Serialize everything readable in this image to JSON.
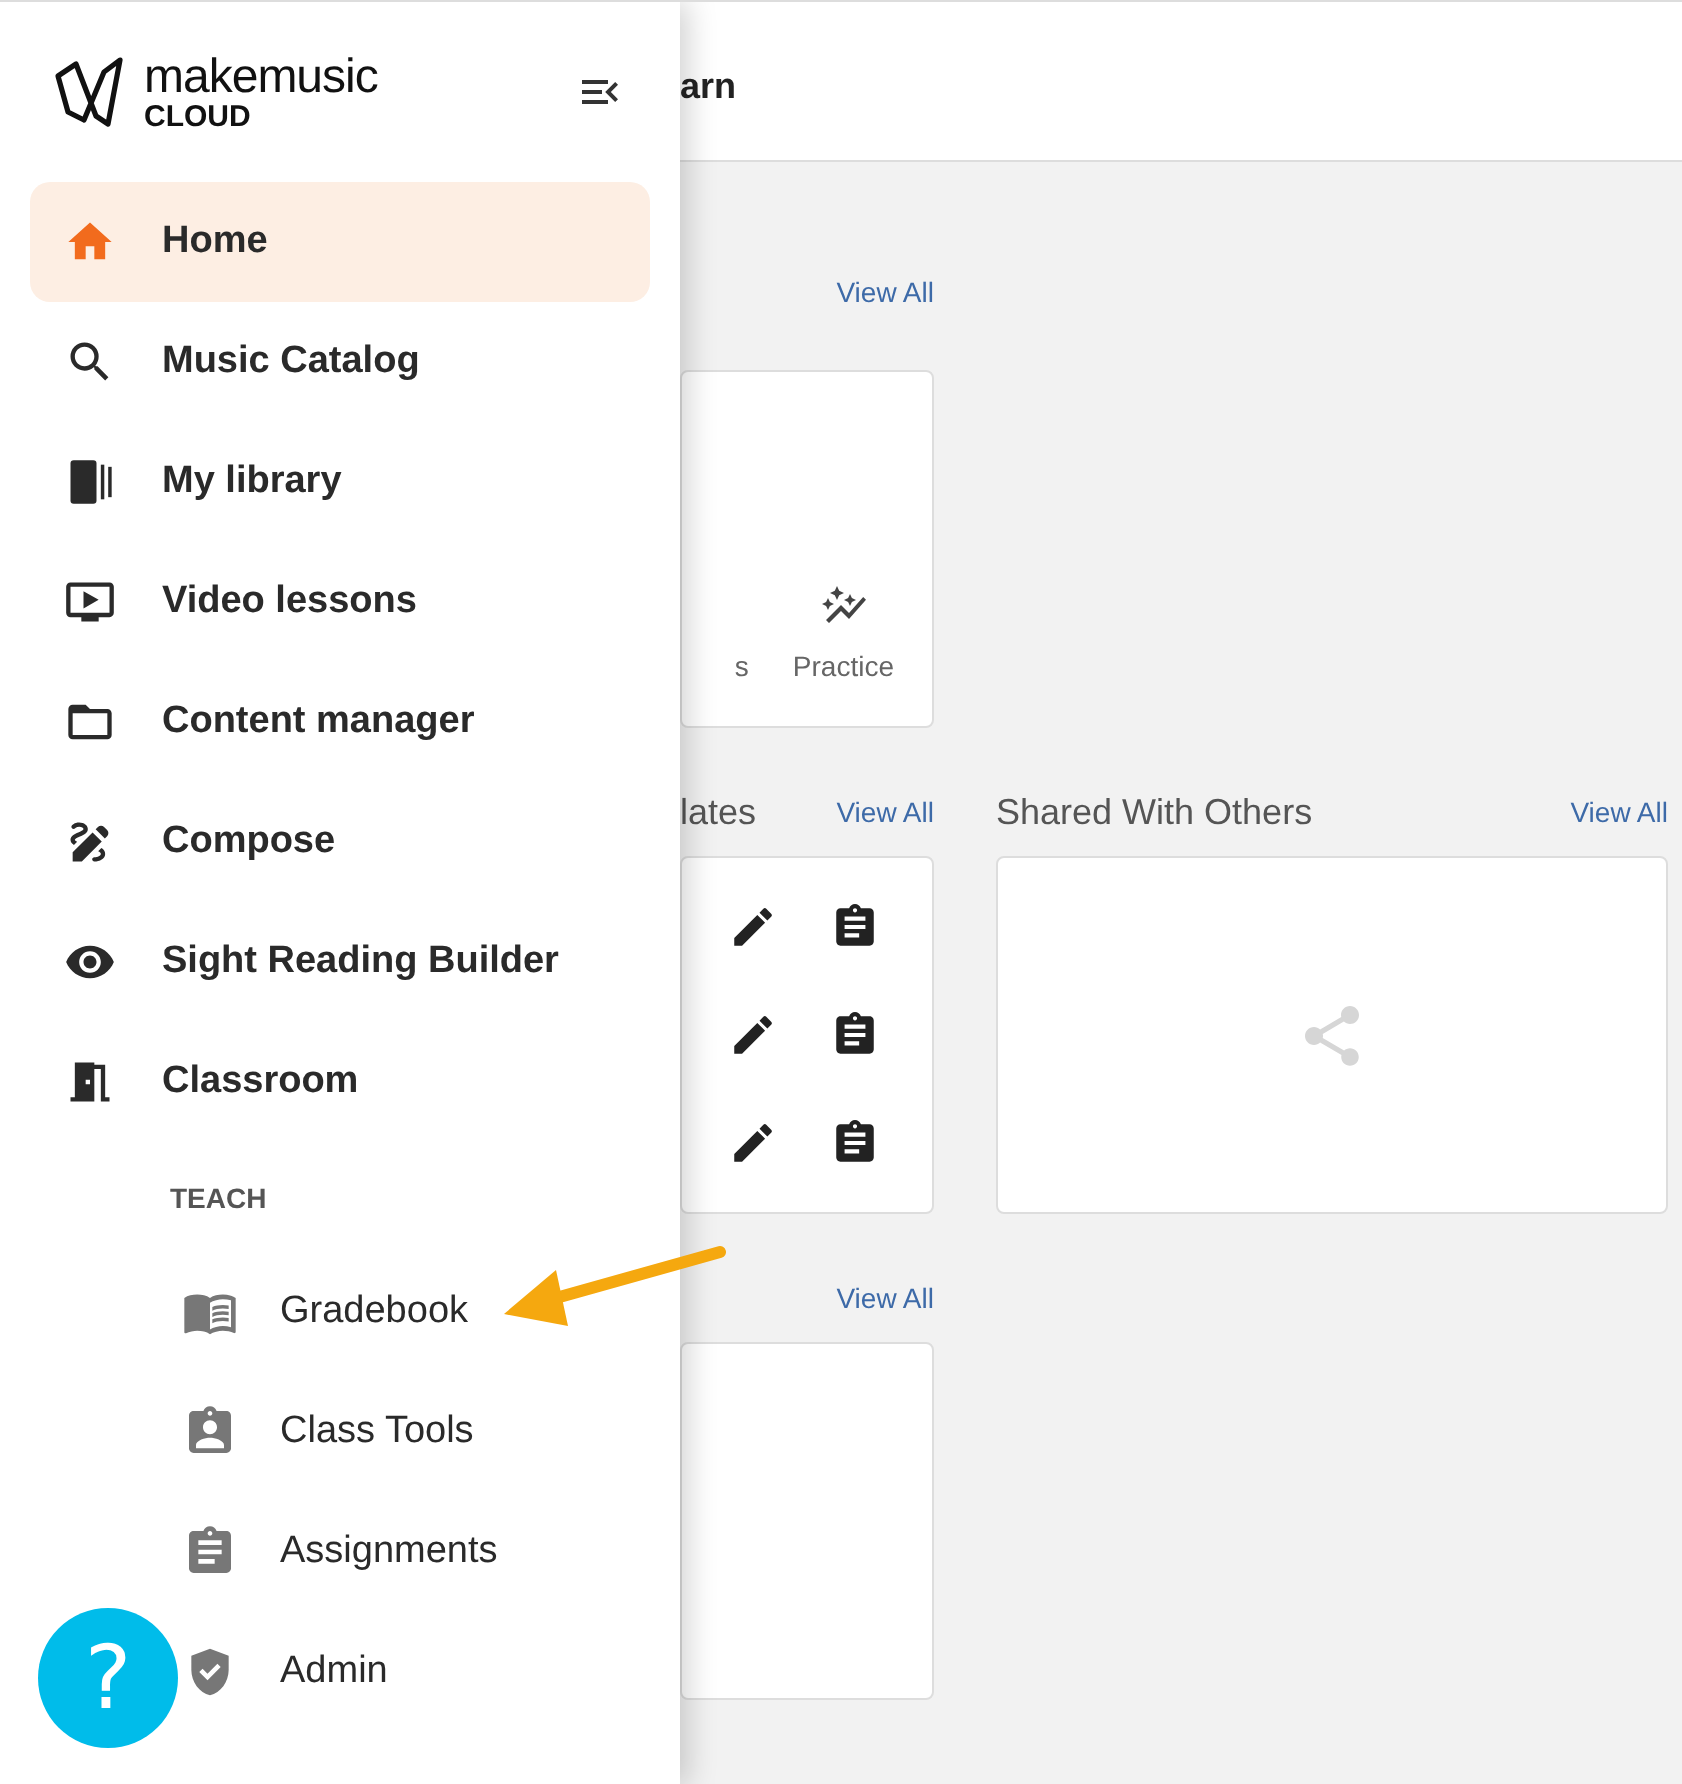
{
  "header": {
    "title": "arn"
  },
  "sections": [
    {
      "view_all": "View All",
      "card": {
        "kind": "tiles",
        "tiles": [
          {
            "label": "s",
            "kind": "text"
          },
          {
            "label": "Practice",
            "kind": "practice"
          }
        ]
      }
    },
    {
      "title": "lates",
      "view_all": "View All",
      "card": {
        "kind": "actions"
      }
    },
    {
      "title": "Shared With Others",
      "view_all": "View All",
      "card": {
        "kind": "share"
      }
    },
    {
      "view_all": "View All",
      "card": {
        "kind": "blank"
      }
    }
  ],
  "drawer": {
    "logo": {
      "name": "makemusic",
      "sub": "CLOUD"
    },
    "nav": [
      {
        "label": "Home",
        "selected": true
      },
      {
        "label": "Music Catalog",
        "selected": false
      },
      {
        "label": "My library",
        "selected": false
      },
      {
        "label": "Video lessons",
        "selected": false
      },
      {
        "label": "Content manager",
        "selected": false
      },
      {
        "label": "Compose",
        "selected": false
      },
      {
        "label": "Sight Reading Builder",
        "selected": false
      },
      {
        "label": "Classroom",
        "selected": false
      }
    ],
    "section": {
      "title": "TEACH",
      "items": [
        {
          "label": "Gradebook",
          "selected": false
        },
        {
          "label": "Class Tools",
          "selected": false
        },
        {
          "label": "Assignments",
          "selected": false
        },
        {
          "label": "Admin",
          "selected": false
        }
      ]
    }
  },
  "help": {
    "label": "?"
  }
}
